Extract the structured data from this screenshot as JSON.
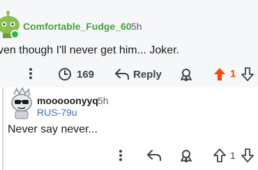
{
  "comment1": {
    "username": "Comfortable_Fudge_60",
    "time": "5h",
    "body": "ven though I'll never get him... Joker.",
    "awards": "169",
    "reply_label": "Reply",
    "votes": "1",
    "colors": {
      "username": "#46a040",
      "upvote_active": "#ff4500",
      "online": "#2fb64e"
    }
  },
  "comment2": {
    "username": "mooooonyyq",
    "time": "5h",
    "flair": "RUS-79u",
    "body": "Never say never...",
    "votes": "1",
    "colors": {
      "flair": "#356fc0"
    }
  },
  "icons": [
    "more-icon",
    "award-icon",
    "reply-icon",
    "share-icon",
    "upvote-icon",
    "downvote-icon"
  ]
}
